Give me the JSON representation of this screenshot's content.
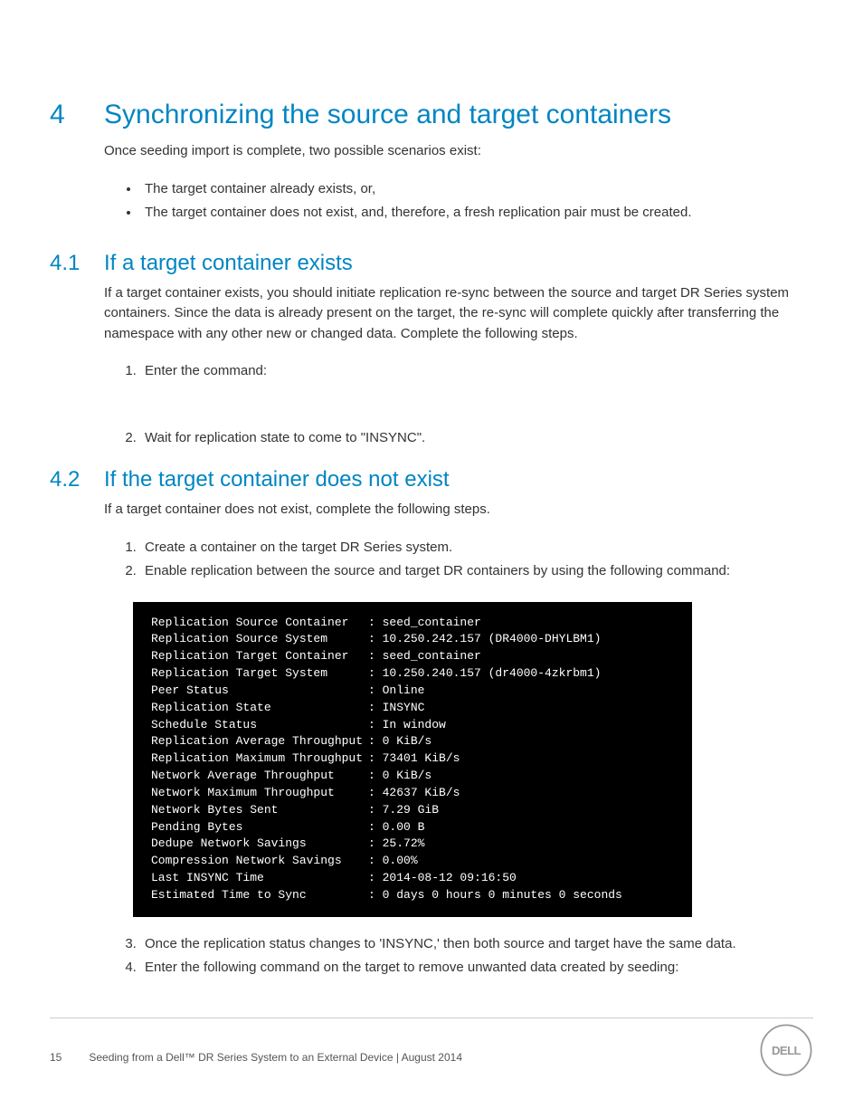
{
  "section4": {
    "num": "4",
    "title": "Synchronizing the source and target containers",
    "intro": "Once seeding import is complete, two possible scenarios exist:",
    "bullets": [
      "The target container already exists, or,",
      "The target container does not exist, and, therefore, a fresh replication pair must be created."
    ]
  },
  "section41": {
    "num": "4.1",
    "title": "If a target container exists",
    "intro": "If a target container exists, you should initiate replication re-sync between the source and target DR Series system containers. Since the data is already present on the target, the re-sync will complete quickly after transferring the namespace with any other new or changed data. Complete the following steps.",
    "steps": [
      "Enter the command:",
      "Wait for replication state to come to \"INSYNC\"."
    ]
  },
  "section42": {
    "num": "4.2",
    "title": "If the target container does not exist",
    "intro": "If a target container does not exist, complete the following steps.",
    "steps_a": [
      "Create a container on the target DR Series system.",
      "Enable replication between the source and target DR containers by using the following command:"
    ],
    "steps_b": [
      "Once the replication status changes to 'INSYNC,' then both source and target have the same data.",
      "Enter the following command on the target to remove unwanted data created by seeding:"
    ]
  },
  "terminal": [
    {
      "label": "Replication Source Container",
      "value": "seed_container"
    },
    {
      "label": "Replication Source System",
      "value": "10.250.242.157 (DR4000-DHYLBM1)"
    },
    {
      "label": "Replication Target Container",
      "value": "seed_container"
    },
    {
      "label": "Replication Target System",
      "value": "10.250.240.157 (dr4000-4zkrbm1)"
    },
    {
      "label": "Peer Status",
      "value": "Online"
    },
    {
      "label": "Replication State",
      "value": "INSYNC"
    },
    {
      "label": "Schedule Status",
      "value": "In window"
    },
    {
      "label": "Replication Average Throughput",
      "value": "0 KiB/s"
    },
    {
      "label": "Replication Maximum Throughput",
      "value": "73401 KiB/s"
    },
    {
      "label": "Network Average Throughput",
      "value": "0 KiB/s"
    },
    {
      "label": "Network Maximum Throughput",
      "value": "42637 KiB/s"
    },
    {
      "label": "Network Bytes Sent",
      "value": "7.29 GiB"
    },
    {
      "label": "Pending Bytes",
      "value": "0.00 B"
    },
    {
      "label": "Dedupe Network Savings",
      "value": "25.72%"
    },
    {
      "label": "Compression Network Savings",
      "value": "0.00%"
    },
    {
      "label": "Last INSYNC Time",
      "value": "2014-08-12 09:16:50"
    },
    {
      "label": "Estimated Time to Sync",
      "value": "0 days 0 hours 0 minutes 0 seconds"
    }
  ],
  "footer": {
    "page": "15",
    "title": "Seeding from a Dell™ DR Series System to an External Device | August 2014"
  }
}
